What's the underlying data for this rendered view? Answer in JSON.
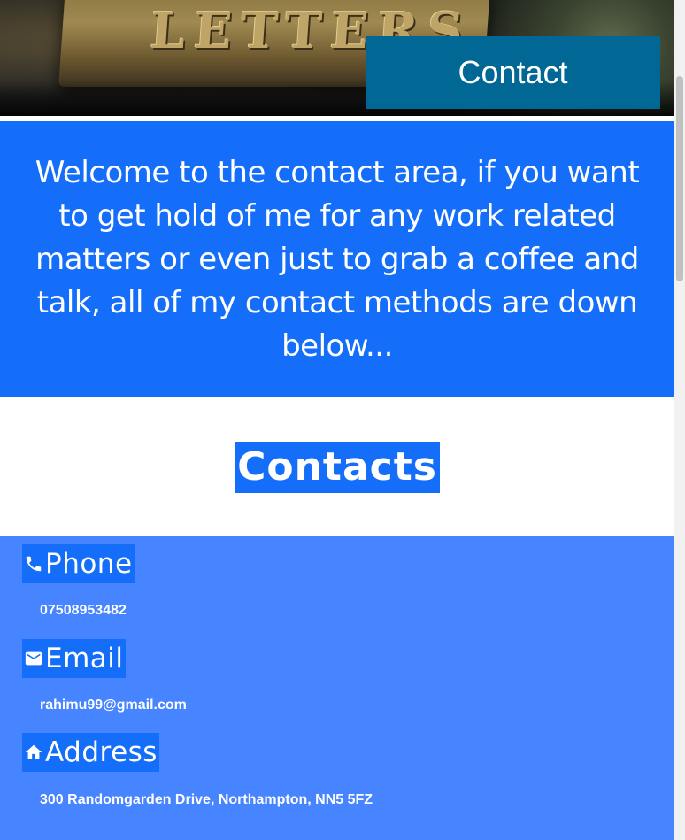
{
  "hero": {
    "sign_text": "LETTERS",
    "contact_label": "Contact"
  },
  "welcome": {
    "text": "Welcome to the contact area, if you want to get hold of me for any work related matters or even just to grab a coffee and talk, all of my contact methods are down below..."
  },
  "contacts": {
    "title": "Contacts",
    "items": [
      {
        "icon": "phone-icon",
        "label": "Phone",
        "value": "07508953482"
      },
      {
        "icon": "email-icon",
        "label": "Email",
        "value": "rahimu99@gmail.com"
      },
      {
        "icon": "home-icon",
        "label": "Address",
        "value": "300 Randomgarden Drive, Northampton, NN5 5FZ"
      }
    ]
  },
  "colors": {
    "hero_box": "#016795",
    "primary_blue": "#146efa",
    "section_blue": "#4784ff"
  }
}
